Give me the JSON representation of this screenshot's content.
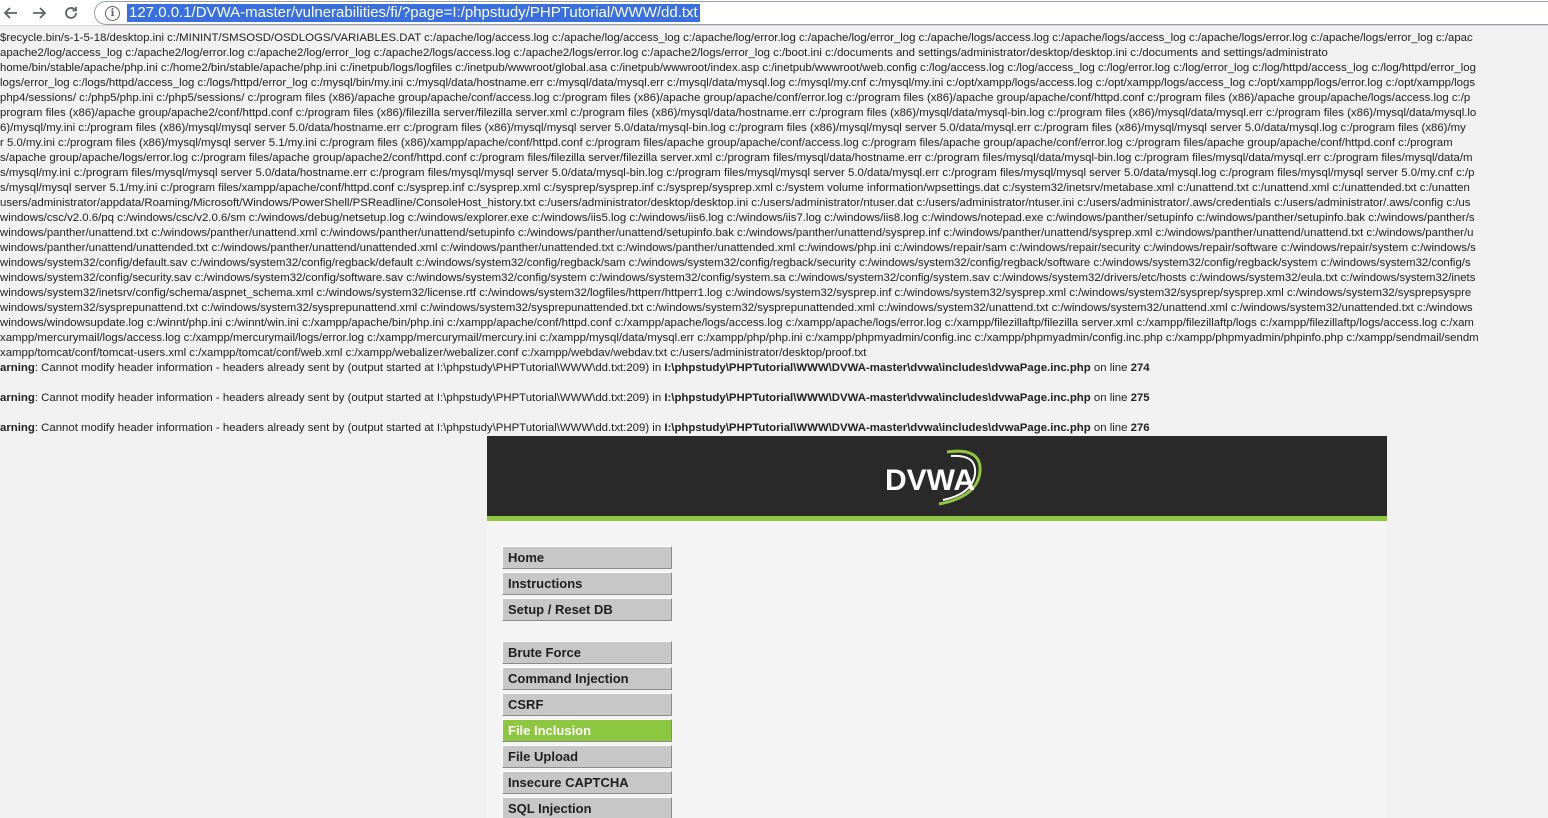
{
  "browser": {
    "url": "127.0.0.1/DVWA-master/vulnerabilities/fi/?page=I:/phpstudy/PHPTutorial/WWW/dd.txt"
  },
  "dump_lines": [
    "$recycle.bin/s-1-5-18/desktop.ini c:/MININT/SMSOSD/OSDLOGS/VARIABLES.DAT c:/apache/log/access.log c:/apache/log/access_log c:/apache/log/error.log c:/apache/log/error_log c:/apache/logs/access.log c:/apache/logs/access_log c:/apache/logs/error.log c:/apache/logs/error_log c:/apac",
    "apache2/log/access_log c:/apache2/log/error.log c:/apache2/log/error_log c:/apache2/logs/access.log c:/apache2/logs/error.log c:/apache2/logs/error_log c:/boot.ini c:/documents and settings/administrator/desktop/desktop.ini c:/documents and settings/administrato",
    "home/bin/stable/apache/php.ini c:/home2/bin/stable/apache/php.ini c:/inetpub/logs/logfiles c:/inetpub/wwwroot/global.asa c:/inetpub/wwwroot/index.asp c:/inetpub/wwwroot/web.config c:/log/access.log c:/log/access_log c:/log/error.log c:/log/error_log c:/log/httpd/access_log c:/log/httpd/error_log",
    "logs/error_log c:/logs/httpd/access_log c:/logs/httpd/error_log c:/mysql/bin/my.ini c:/mysql/data/hostname.err c:/mysql/data/mysql.err c:/mysql/data/mysql.log c:/mysql/my.cnf c:/mysql/my.ini c:/opt/xampp/logs/access.log c:/opt/xampp/logs/access_log c:/opt/xampp/logs/error.log c:/opt/xampp/logs",
    "php4/sessions/ c:/php5/php.ini c:/php5/sessions/ c:/program files (x86)/apache group/apache/conf/access.log c:/program files (x86)/apache group/apache/conf/error.log c:/program files (x86)/apache group/apache/conf/httpd.conf c:/program files (x86)/apache group/apache/logs/access.log c:/p",
    "program files (x86)/apache group/apache2/conf/httpd.conf c:/program files (x86)/filezilla server/filezilla server.xml c:/program files (x86)/mysql/data/hostname.err c:/program files (x86)/mysql/data/mysql-bin.log c:/program files (x86)/mysql/data/mysql.err c:/program files (x86)/mysql/data/mysql.lo",
    "6)/mysql/my.ini c:/program files (x86)/mysql/mysql server 5.0/data/hostname.err c:/program files (x86)/mysql/mysql server 5.0/data/mysql-bin.log c:/program files (x86)/mysql/mysql server 5.0/data/mysql.err c:/program files (x86)/mysql/mysql server 5.0/data/mysql.log c:/program files (x86)/my",
    "r 5.0/my.ini c:/program files (x86)/mysql/mysql server 5.1/my.ini c:/program files (x86)/xampp/apache/conf/httpd.conf c:/program files/apache group/apache/conf/access.log c:/program files/apache group/apache/conf/error.log c:/program files/apache group/apache/conf/httpd.conf c:/program",
    "s/apache group/apache/logs/error.log c:/program files/apache group/apache2/conf/httpd.conf c:/program files/filezilla server/filezilla server.xml c:/program files/mysql/data/hostname.err c:/program files/mysql/data/mysql-bin.log c:/program files/mysql/data/mysql.err c:/program files/mysql/data/m",
    "s/mysql/my.ini c:/program files/mysql/mysql server 5.0/data/hostname.err c:/program files/mysql/mysql server 5.0/data/mysql-bin.log c:/program files/mysql/mysql server 5.0/data/mysql.err c:/program files/mysql/mysql server 5.0/data/mysql.log c:/program files/mysql/mysql server 5.0/my.cnf c:/p",
    "s/mysql/mysql server 5.1/my.ini c:/program files/xampp/apache/conf/httpd.conf c:/sysprep.inf c:/sysprep.xml c:/sysprep/sysprep.inf c:/sysprep/sysprep.xml c:/system volume information/wpsettings.dat c:/system32/inetsrv/metabase.xml c:/unattend.txt c:/unattend.xml c:/unattended.txt c:/unatten",
    "users/administrator/appdata/Roaming/Microsoft/Windows/PowerShell/PSReadline/ConsoleHost_history.txt c:/users/administrator/desktop/desktop.ini c:/users/administrator/ntuser.dat c:/users/administrator/ntuser.ini c:/users/administrator/.aws/credentials c:/users/administrator/.aws/config c:/us",
    "windows/csc/v2.0.6/pq c:/windows/csc/v2.0.6/sm c:/windows/debug/netsetup.log c:/windows/explorer.exe c:/windows/iis5.log c:/windows/iis6.log c:/windows/iis7.log c:/windows/iis8.log c:/windows/notepad.exe c:/windows/panther/setupinfo c:/windows/panther/setupinfo.bak c:/windows/panther/s",
    "windows/panther/unattend.txt c:/windows/panther/unattend.xml c:/windows/panther/unattend/setupinfo c:/windows/panther/unattend/setupinfo.bak c:/windows/panther/unattend/sysprep.inf c:/windows/panther/unattend/sysprep.xml c:/windows/panther/unattend/unattend.txt c:/windows/panther/u",
    "windows/panther/unattend/unattended.txt c:/windows/panther/unattend/unattended.xml c:/windows/panther/unattended.txt c:/windows/panther/unattended.xml c:/windows/php.ini c:/windows/repair/sam c:/windows/repair/security c:/windows/repair/software c:/windows/repair/system c:/windows/s",
    "windows/system32/config/default.sav c:/windows/system32/config/regback/default c:/windows/system32/config/regback/sam c:/windows/system32/config/regback/security c:/windows/system32/config/regback/software c:/windows/system32/config/regback/system c:/windows/system32/config/s",
    "windows/system32/config/security.sav c:/windows/system32/config/software.sav c:/windows/system32/config/system c:/windows/system32/config/system.sa c:/windows/system32/config/system.sav c:/windows/system32/drivers/etc/hosts c:/windows/system32/eula.txt c:/windows/system32/inets",
    "windows/system32/inetsrv/config/schema/aspnet_schema.xml c:/windows/system32/license.rtf c:/windows/system32/logfiles/httperr/httperr1.log c:/windows/system32/sysprep.inf c:/windows/system32/sysprep.xml c:/windows/system32/sysprep/sysprep.xml c:/windows/system32/sysprepsyspre",
    "windows/system32/sysprepunattend.txt c:/windows/system32/sysprepunattend.xml c:/windows/system32/sysprepunattended.txt c:/windows/system32/sysprepunattended.xml c:/windows/system32/unattend.txt c:/windows/system32/unattend.xml c:/windows/system32/unattended.txt c:/windows",
    "windows/windowsupdate.log c:/winnt/php.ini c:/winnt/win.ini c:/xampp/apache/bin/php.ini c:/xampp/apache/conf/httpd.conf c:/xampp/apache/logs/access.log c:/xampp/apache/logs/error.log c:/xampp/filezillaftp/filezilla server.xml c:/xampp/filezillaftp/logs c:/xampp/filezillaftp/logs/access.log c:/xam",
    "xampp/mercurymail/logs/access.log c:/xampp/mercurymail/logs/error.log c:/xampp/mercurymail/mercury.ini c:/xampp/mysql/data/mysql.err c:/xampp/php/php.ini c:/xampp/phpmyadmin/config.inc c:/xampp/phpmyadmin/config.inc.php c:/xampp/phpmyadmin/phpinfo.php c:/xampp/sendmail/sendm",
    "xampp/tomcat/conf/tomcat-users.xml c:/xampp/tomcat/conf/web.xml c:/xampp/webalizer/webalizer.conf c:/xampp/webdav/webdav.txt c:/users/administrator/desktop/proof.txt"
  ],
  "warnings": [
    {
      "label": "arning",
      "text": ": Cannot modify header information - headers already sent by (output started at I:\\phpstudy\\PHPTutorial\\WWW\\dd.txt:209) in ",
      "file": "I:\\phpstudy\\PHPTutorial\\WWW\\DVWA-master\\dvwa\\includes\\dvwaPage.inc.php",
      "mid": " on line ",
      "line": "274"
    },
    {
      "label": "arning",
      "text": ": Cannot modify header information - headers already sent by (output started at I:\\phpstudy\\PHPTutorial\\WWW\\dd.txt:209) in ",
      "file": "I:\\phpstudy\\PHPTutorial\\WWW\\DVWA-master\\dvwa\\includes\\dvwaPage.inc.php",
      "mid": " on line ",
      "line": "275"
    },
    {
      "label": "arning",
      "text": ": Cannot modify header information - headers already sent by (output started at I:\\phpstudy\\PHPTutorial\\WWW\\dd.txt:209) in ",
      "file": "I:\\phpstudy\\PHPTutorial\\WWW\\DVWA-master\\dvwa\\includes\\dvwaPage.inc.php",
      "mid": " on line ",
      "line": "276"
    }
  ],
  "dvwa": {
    "logo_text": "DVWA",
    "colors": {
      "header": "#2a2a2a",
      "accent": "#8ec63f",
      "menu": "#c7c7c7"
    },
    "menu_group1": [
      "Home",
      "Instructions",
      "Setup / Reset DB"
    ],
    "menu_group2": [
      "Brute Force",
      "Command Injection",
      "CSRF",
      "File Inclusion",
      "File Upload",
      "Insecure CAPTCHA",
      "SQL Injection"
    ],
    "active_item": "File Inclusion"
  }
}
